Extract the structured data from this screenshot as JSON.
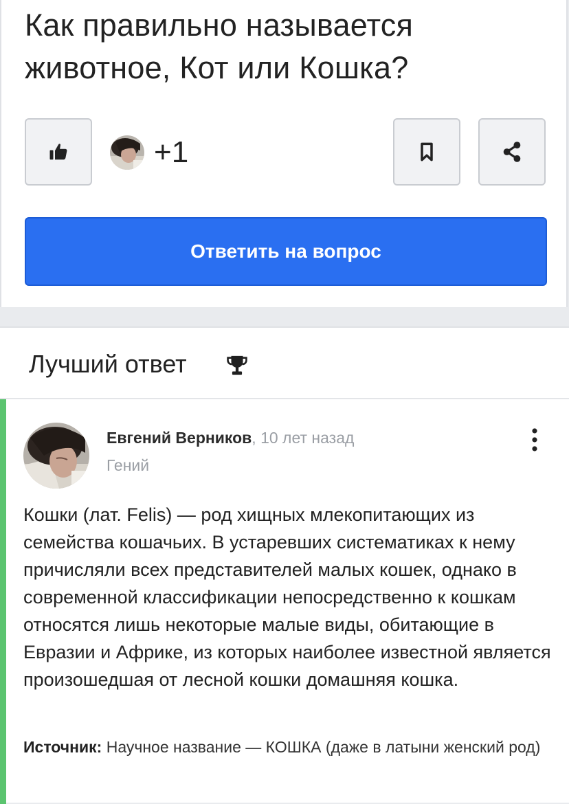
{
  "question": {
    "title": "Как правильно называется животное, Кот или Кошка?",
    "likers_count": "+1",
    "answer_button_label": "Ответить на вопрос"
  },
  "icons": {
    "like": "thumbs-up-icon",
    "bookmark": "bookmark-icon",
    "share": "share-icon",
    "trophy": "trophy-icon",
    "more": "more-vertical-icon"
  },
  "best_answer": {
    "header": "Лучший ответ",
    "author": {
      "name": "Евгений Верников",
      "separator": ",",
      "time": "10 лет назад",
      "rank": "Гений"
    },
    "text": "Кошки (лат. Felis) — род хищных млекопитающих из семейства кошачьих. В устаревших систематиках к нему причисляли всех представителей малых кошек, однако в современной классификации непосредственно к кошкам относятся лишь некоторые малые виды, обитающие в Евразии и Африке, из которых наиболее известной является произошедшая от лесной кошки домашняя кошка.",
    "source_label": "Источник:",
    "source_text": "Научное название — КОШКА (даже в латыни женский род)"
  },
  "colors": {
    "accent_blue": "#2a6ff1",
    "best_answer_green": "#5bc46f",
    "muted_text": "#9a9ea4"
  }
}
